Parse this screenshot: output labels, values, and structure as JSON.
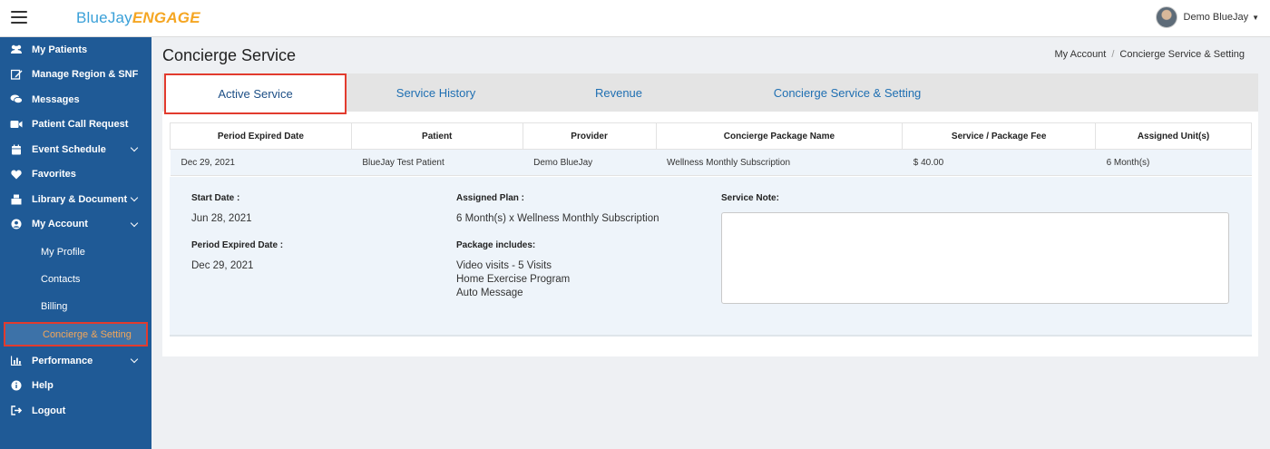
{
  "header": {
    "logo_part1": "BlueJay",
    "logo_part2": "ENGAGE",
    "user_name": "Demo BlueJay"
  },
  "sidebar": {
    "items": [
      {
        "label": "My Patients",
        "icon": "users-icon"
      },
      {
        "label": "Manage Region & SNF",
        "icon": "edit-icon"
      },
      {
        "label": "Messages",
        "icon": "comments-icon"
      },
      {
        "label": "Patient Call Request",
        "icon": "video-icon"
      },
      {
        "label": "Event Schedule",
        "icon": "calendar-icon"
      },
      {
        "label": "Favorites",
        "icon": "heart-icon"
      },
      {
        "label": "Library & Document",
        "icon": "library-icon"
      },
      {
        "label": "My Account",
        "icon": "user-circle-icon"
      }
    ],
    "sub_items": [
      "My Profile",
      "Contacts",
      "Billing",
      "Concierge & Setting"
    ],
    "bottom_items": [
      {
        "label": "Performance",
        "icon": "chart-icon"
      },
      {
        "label": "Help",
        "icon": "info-icon"
      },
      {
        "label": "Logout",
        "icon": "logout-icon"
      }
    ]
  },
  "page": {
    "title": "Concierge Service",
    "breadcrumb": [
      "My Account",
      "Concierge Service & Setting"
    ]
  },
  "tabs": [
    "Active Service",
    "Service History",
    "Revenue",
    "Concierge Service & Setting"
  ],
  "table": {
    "headers": [
      "Period Expired Date",
      "Patient",
      "Provider",
      "Concierge Package Name",
      "Service / Package Fee",
      "Assigned Unit(s)"
    ],
    "row": [
      "Dec 29, 2021",
      "BlueJay Test Patient",
      "Demo BlueJay",
      "Wellness Monthly Subscription",
      "$ 40.00",
      "6 Month(s)"
    ]
  },
  "details": {
    "start_date_label": "Start Date :",
    "start_date": "Jun 28, 2021",
    "period_expired_label": "Period Expired Date :",
    "period_expired": "Dec 29, 2021",
    "assigned_plan_label": "Assigned Plan :",
    "assigned_plan": "6 Month(s) x Wellness Monthly Subscription",
    "package_includes_label": "Package includes:",
    "package_includes": [
      "Video visits - 5 Visits",
      "Home Exercise Program",
      "Auto Message"
    ],
    "service_note_label": "Service Note:",
    "service_note": ""
  },
  "colors": {
    "sidebar_bg": "#1f5a96",
    "link_blue": "#1f6fb2",
    "highlight_red": "#e23b2e",
    "active_sub_text": "#f2a65a"
  }
}
